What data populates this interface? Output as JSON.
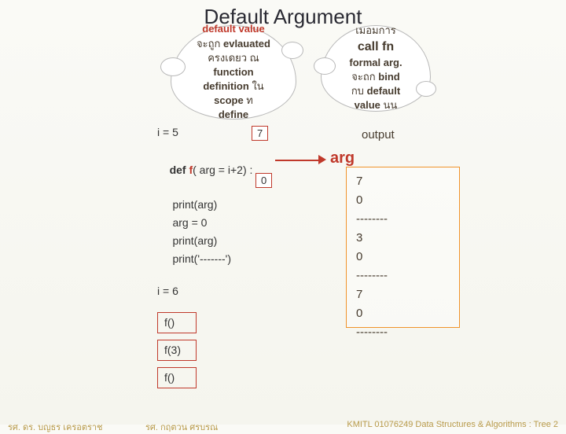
{
  "title": "Default Argument",
  "cloud_left": {
    "l1": "default value",
    "l2a": "จะถูก ",
    "l2b": "evlauated",
    "l3": "ครงเดยว     ณ",
    "l4": "function",
    "l5a": "definition ",
    "l5b": "ใน",
    "l6a": "scope ",
    "l6b": "ท",
    "l7": "define"
  },
  "cloud_right": {
    "l1": "เมอมการ",
    "l2": "call fn",
    "l3": "formal arg.",
    "l4a": "จะถก  ",
    "l4b": "bind",
    "l5a": "กบ  ",
    "l5b": "default",
    "l6a": "value ",
    "l6b": "นน"
  },
  "code": {
    "i5": "i = 5",
    "def_kw": "def ",
    "def_name": "f",
    "def_rest": "( arg = i+2) :",
    "body1": "     print(arg)",
    "body2": "     arg = 0",
    "body3": "     print(arg)",
    "body4": "     print('-------')",
    "i6": "i = 6",
    "call1": "f()",
    "call2": "f(3)",
    "call3": "f()"
  },
  "badge7": "7",
  "badge0": "0",
  "output_label": "output",
  "arg_label": "arg",
  "output_lines": [
    "7",
    "0",
    "--------",
    "3",
    "0",
    "--------",
    "7",
    "0",
    "--------"
  ],
  "footer": {
    "left": "รศ. ดร. บญธร     เครอตราช",
    "mid": "รศ. กฤตวน   ศรบรณ",
    "right": "KMITL   01076249 Data Structures & Algorithms : Tree 2"
  }
}
